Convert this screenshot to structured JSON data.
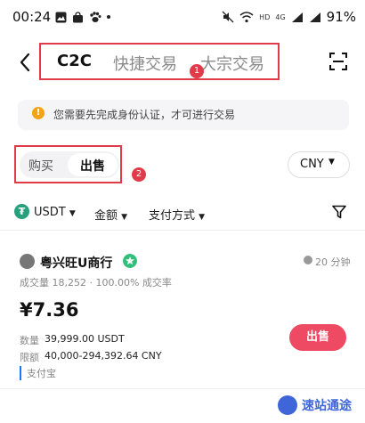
{
  "status_bar": {
    "time": "00:24",
    "battery": "91%",
    "network_label": "HD",
    "signal_label": "4G"
  },
  "header": {
    "tabs": [
      {
        "label": "C2C",
        "active": true
      },
      {
        "label": "快捷交易",
        "active": false
      },
      {
        "label": "大宗交易",
        "active": false
      }
    ],
    "annotation_badge": "1"
  },
  "notice": {
    "text": "您需要先完成身份认证，才可进行交易"
  },
  "trade_toggle": {
    "buy_label": "购买",
    "sell_label": "出售",
    "selected": "出售",
    "annotation_badge": "2"
  },
  "currency": {
    "selected": "CNY"
  },
  "filters": {
    "asset": "USDT",
    "amount": "金额",
    "payment": "支付方式"
  },
  "ad": {
    "merchant_name": "粤兴旺U商行",
    "response_time": "20 分钟",
    "stats": "成交量 18,252 · 100.00% 成交率",
    "price": "¥7.36",
    "quantity_label": "数量",
    "quantity_value": "39,999.00 USDT",
    "limit_label": "限额",
    "limit_value": "40,000-294,392.64 CNY",
    "payment_method": "支付宝",
    "action_label": "出售"
  },
  "watermark": {
    "text": "速站通途"
  },
  "colors": {
    "accent_red": "#e13a48",
    "sell_button": "#ee4a63",
    "usdt_green": "#26a17b"
  }
}
